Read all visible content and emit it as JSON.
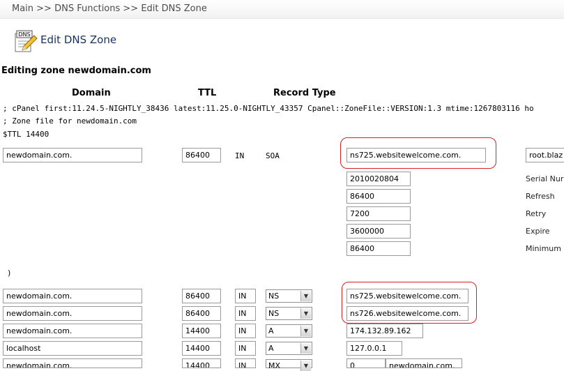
{
  "breadcrumb": "Main >> DNS Functions >> Edit DNS Zone",
  "page_title": "Edit DNS Zone",
  "icon_badge": "DNS",
  "zone_heading": "Editing zone newdomain.com",
  "columns": {
    "domain": "Domain",
    "ttl": "TTL",
    "record_type": "Record Type"
  },
  "zone_comments": [
    "; cPanel first:11.24.5-NIGHTLY_38436 latest:11.25.0-NIGHTLY_43357 Cpanel::ZoneFile::VERSION:1.3 mtime:1267803116 ho",
    "; Zone file for newdomain.com",
    "$TTL 14400"
  ],
  "soa": {
    "domain": "newdomain.com.",
    "ttl": "86400",
    "class": "IN",
    "type": "SOA",
    "primary_ns": "ns725.websitewelcome.com.",
    "contact": "root.blaz",
    "fields": [
      {
        "value": "2010020804",
        "label": "Serial Nur"
      },
      {
        "value": "86400",
        "label": "Refresh"
      },
      {
        "value": "7200",
        "label": "Retry"
      },
      {
        "value": "3600000",
        "label": "Expire"
      },
      {
        "value": "86400",
        "label": "Minimum"
      }
    ],
    "close_paren": ")"
  },
  "records": [
    {
      "domain": "newdomain.com.",
      "ttl": "86400",
      "class": "IN",
      "type": "NS",
      "value": "ns725.websitewelcome.com."
    },
    {
      "domain": "newdomain.com.",
      "ttl": "86400",
      "class": "IN",
      "type": "NS",
      "value": "ns726.websitewelcome.com."
    },
    {
      "domain": "newdomain.com.",
      "ttl": "14400",
      "class": "IN",
      "type": "A",
      "value": "174.132.89.162"
    },
    {
      "domain": "localhost",
      "ttl": "14400",
      "class": "IN",
      "type": "A",
      "value": "127.0.0.1"
    },
    {
      "domain": "newdomain.com.",
      "ttl": "14400",
      "class": "IN",
      "type": "MX",
      "priority": "0",
      "value": "newdomain.com."
    }
  ],
  "highlight_color": "#d72020",
  "title_color": "#16325c"
}
